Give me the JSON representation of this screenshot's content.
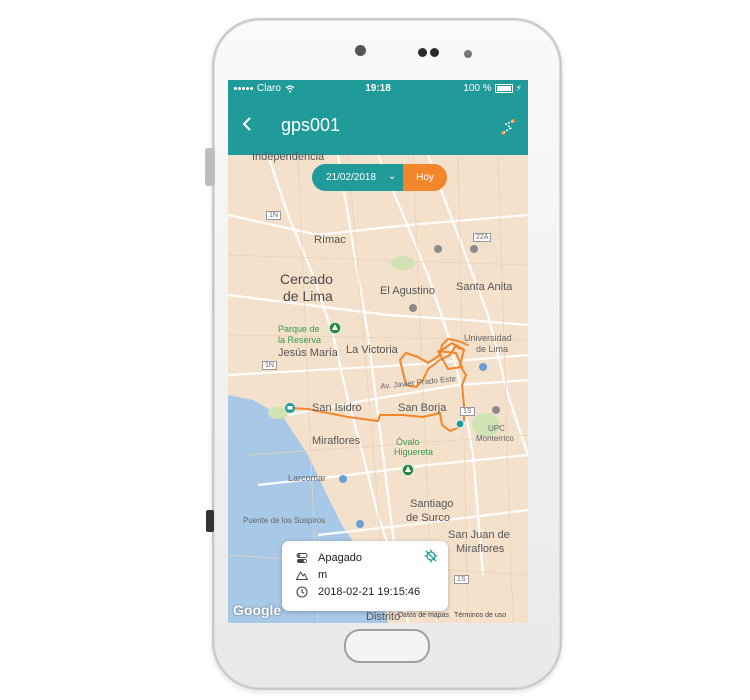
{
  "status_bar": {
    "carrier": "Claro",
    "time": "19:18",
    "battery": "100 %"
  },
  "app_bar": {
    "back_icon": "chevron-left-icon",
    "title": "gps001",
    "route_icon": "route-icon"
  },
  "date_filter": {
    "date": "21/02/2018",
    "today_label": "Hoy"
  },
  "map": {
    "labels": {
      "independencia": "Independencia",
      "rimac": "Rímac",
      "cercado1": "Cercado",
      "cercado2": "de Lima",
      "agustino": "El Agustino",
      "santa_anita": "Santa Anita",
      "parque1": "Parque de",
      "parque2": "la Reserva",
      "jesus_maria": "Jesús María",
      "la_victoria": "La Victoria",
      "univ1": "Universidad",
      "univ2": "de Lima",
      "javier_prado": "Av. Javier Prado Este",
      "san_isidro": "San Isidro",
      "san_borja": "San Borja",
      "upc1": "UPC",
      "upc2": "Monterrico",
      "miraflores": "Miraflores",
      "ovalo1": "Óvalo",
      "ovalo2": "Higuereta",
      "larcomar": "Larcomar",
      "suspiros": "Puente de los Suspiros",
      "surco1": "Santiago",
      "surco2": "de Surco",
      "sjm1": "San Juan de",
      "sjm2": "Miraflores",
      "distrito": "Distrito"
    },
    "shields": {
      "s1": "1N",
      "s2": "1N",
      "s3": "22A",
      "s4": "1S",
      "s5": "1S"
    },
    "google": "Google",
    "credit_data": "Datos de mapas",
    "credit_terms": "Términos de uso",
    "accent": "#f3862a"
  },
  "info_card": {
    "status": "Apagado",
    "altitude": "m",
    "timestamp": "2018-02-21 19:15:46"
  },
  "colors": {
    "primary": "#219a9a",
    "accent": "#f3862a",
    "map_bg": "#f3e1cc",
    "water": "#a8c8e8"
  }
}
